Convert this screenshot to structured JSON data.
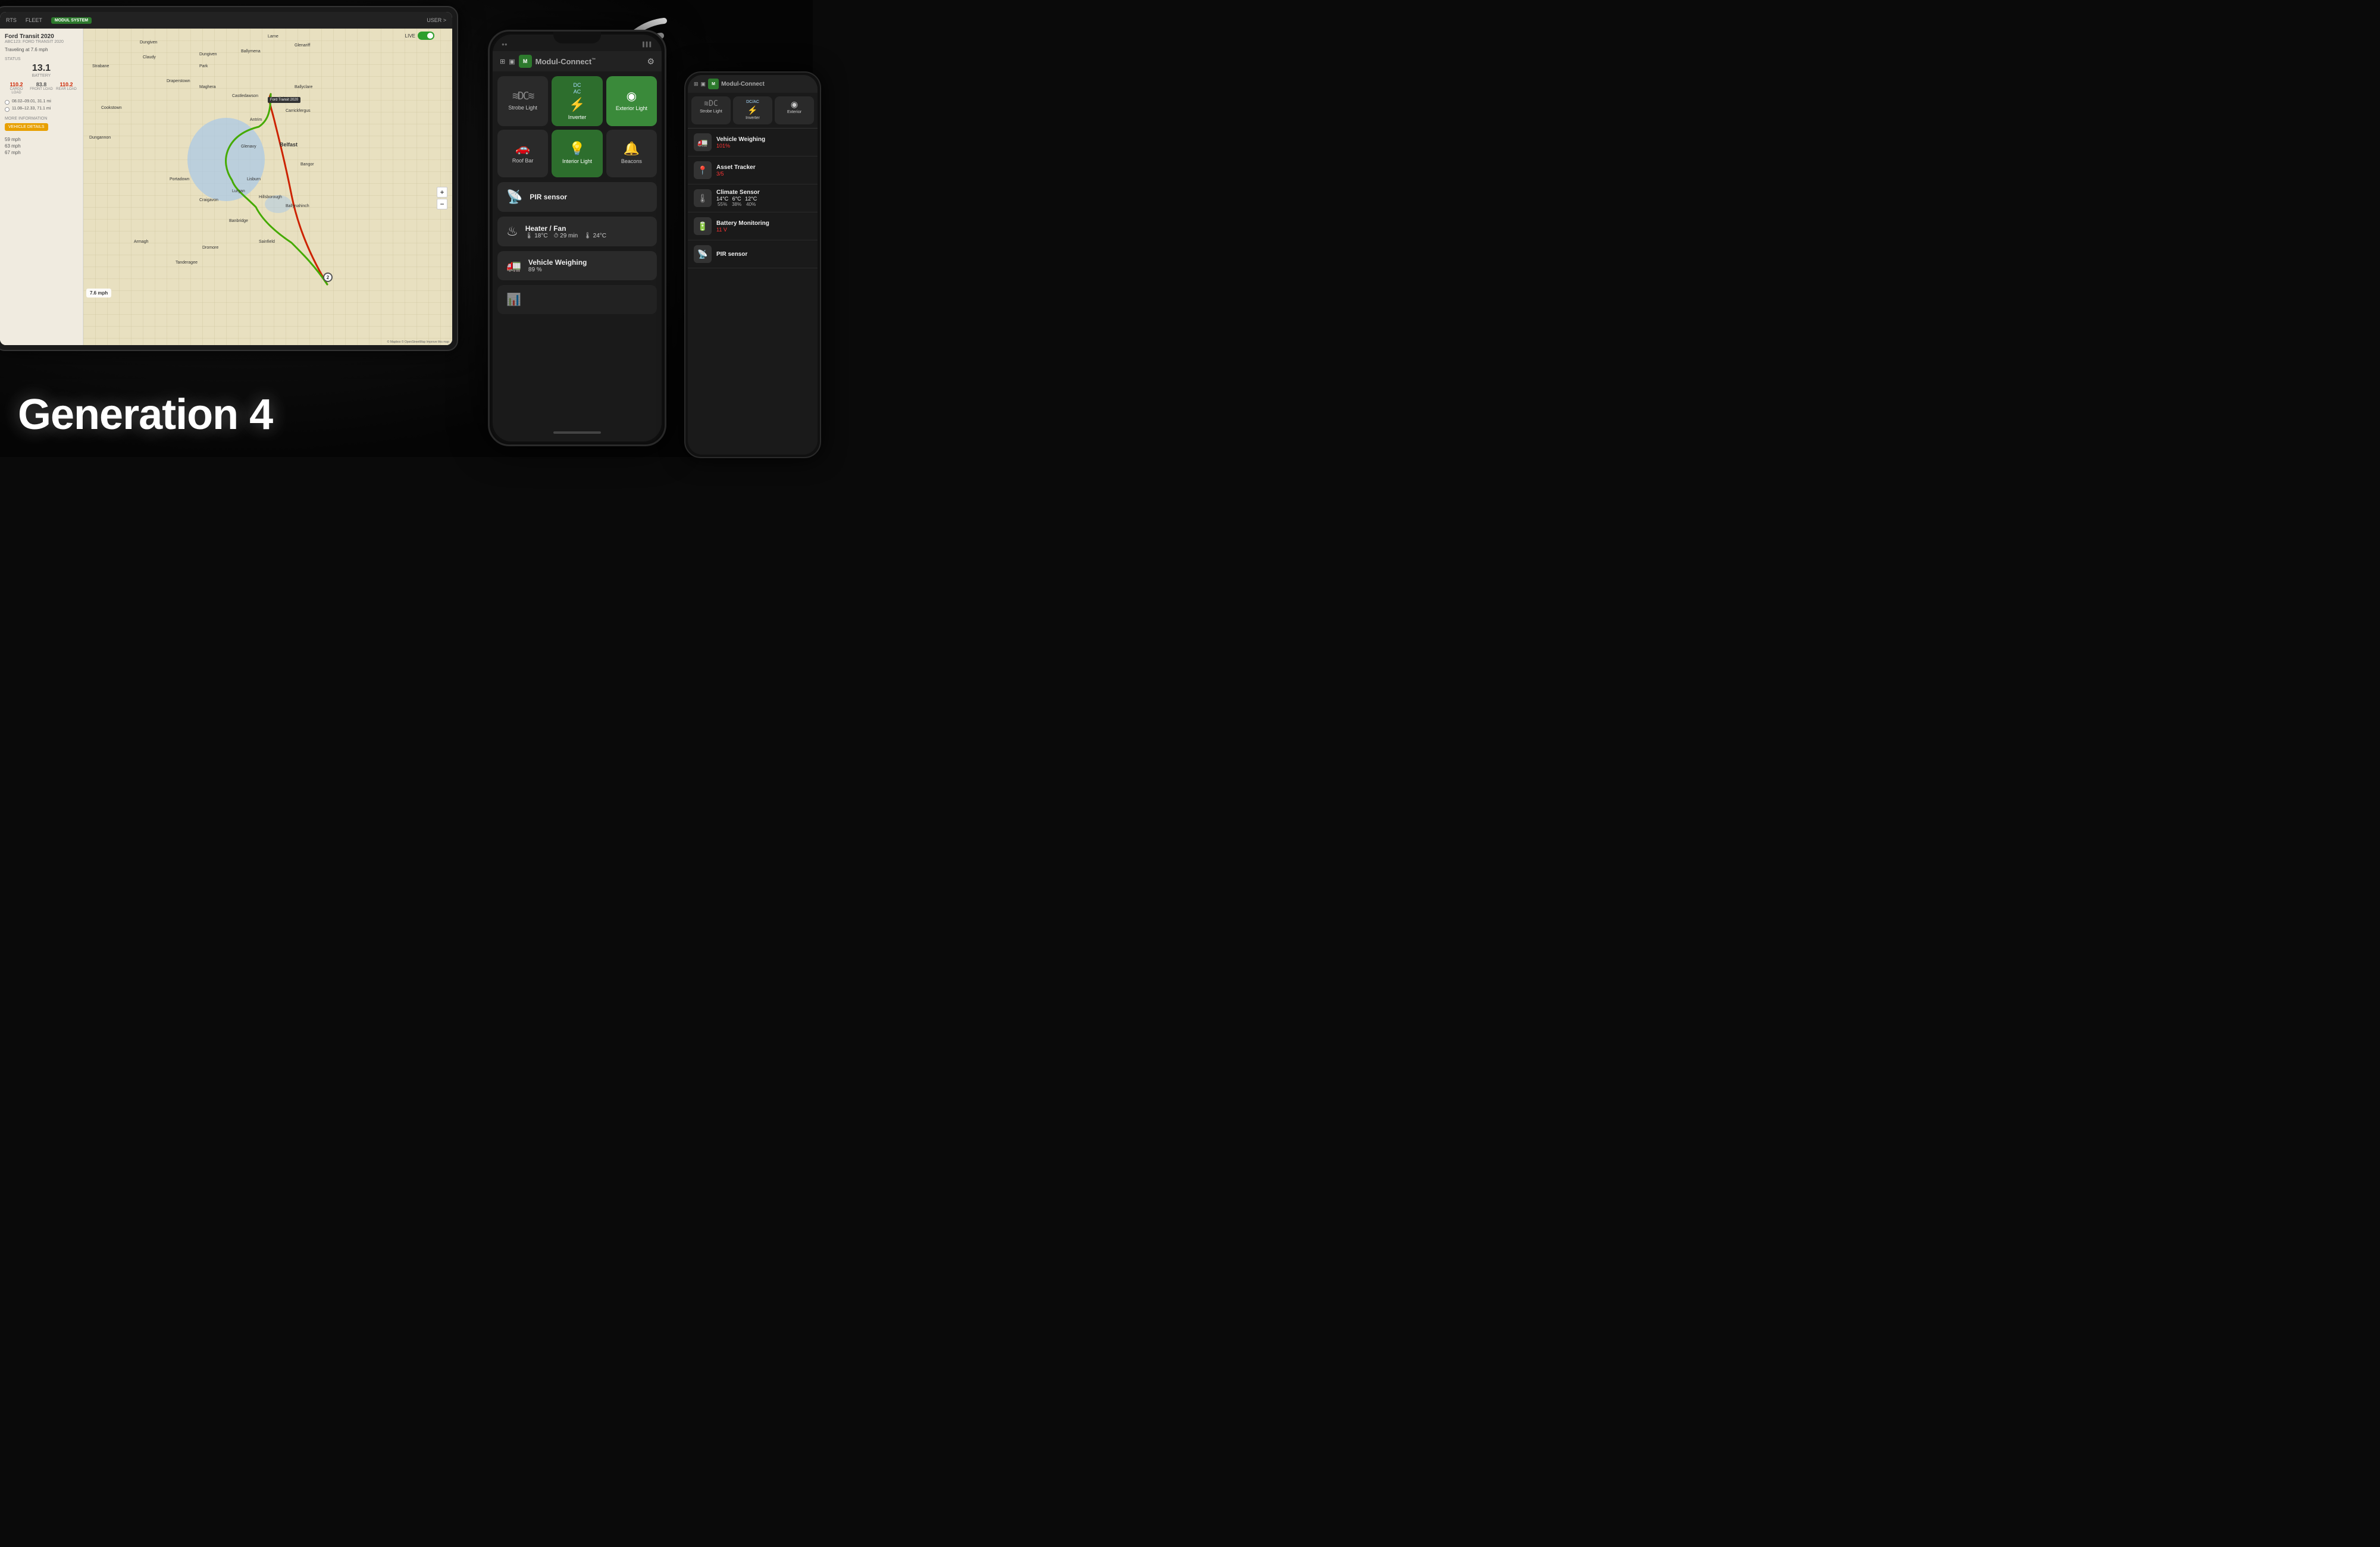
{
  "app": {
    "title": "Modul-Connect™",
    "title_plain": "Modul-Connect",
    "title_tm": "™",
    "subtitle": "Generation 4"
  },
  "tablet": {
    "nav_items": [
      "RTS",
      "FLEET"
    ],
    "modul_badge": "MODUL SYSTEM",
    "user_label": "USER >",
    "vehicle": {
      "name": "Ford Transit 2020",
      "id": "ABC123: FORD TRANSIT 2020",
      "speed_text": "Traveling at 7.6 mph",
      "status_label": "STATUS",
      "battery_value": "13.1",
      "battery_label": "BATTERY",
      "cargo_load": "110.2",
      "cargo_label": "CARGO LOAD",
      "front_load": "83.8",
      "front_label": "FRONT LOAD",
      "rear_load": "110.2",
      "rear_label": "REAR LOAD",
      "trip1": "08.02–09.01, 31.1 mi",
      "trip2": "11.08–12.33, 71.1 mi",
      "more_info": "MORE INFORMATION",
      "vehicle_details_btn": "VEHICLE DETAILS",
      "speed1": "59 mph",
      "speed2": "63 mph",
      "speed3": "67 mph",
      "current_speed": "7.6 mph",
      "live_label": "LIVE"
    },
    "map": {
      "vehicle_marker": "Ford Transit 2020",
      "attribution": "© Mapbox © OpenStreetMap Improve this map",
      "marker_number": "2"
    }
  },
  "phone": {
    "header": {
      "app_name": "Modul-",
      "app_name2": "Connect",
      "app_tm": "™",
      "gear_icon": "⚙",
      "grid_icon": "⊞"
    },
    "grid": [
      {
        "label": "Strobe Light",
        "icon": "≋DC≋",
        "active": false
      },
      {
        "label": "Inverter",
        "sublabel": "DC\nAC",
        "icon": "⚡",
        "active": true
      },
      {
        "label": "Exterior Light",
        "icon": "≡◎≡",
        "active": true
      },
      {
        "label": "Roof Bar",
        "icon": "🚗",
        "active": false
      },
      {
        "label": "Interior Light",
        "icon": "💡",
        "active": true
      },
      {
        "label": "Beacons",
        "icon": "🔔",
        "active": false
      }
    ],
    "sensors": [
      {
        "name": "PIR sensor",
        "icon": "📡",
        "type": "pir"
      },
      {
        "name": "Heater / Fan",
        "icon": "♨",
        "temp": "18°C",
        "time": "29 min",
        "fan_temp": "24°C",
        "type": "heater"
      },
      {
        "name": "Vehicle Weighing",
        "value": "89 %",
        "icon": "🚛",
        "type": "weighing"
      }
    ]
  },
  "phone2": {
    "header": {
      "app_name": "Modul-",
      "app_name2": "Connect"
    },
    "grid_items": [
      {
        "label": "Strobe Light",
        "icon": "≋DC"
      },
      {
        "label": "Inverter",
        "sublabel": "DC/AC",
        "icon": "⚡"
      },
      {
        "label": "Exterior",
        "icon": "◎"
      }
    ],
    "list_items": [
      {
        "name": "Vehicle Weighing",
        "value": "101%",
        "value_color": "red",
        "icon": "🚛"
      },
      {
        "name": "Asset Tracker",
        "value": "3/5",
        "value_color": "red",
        "icon": "📍"
      },
      {
        "name": "Climate Sensor",
        "type": "climate",
        "temps": [
          "14°C",
          "6°C",
          "12°C"
        ],
        "pcts": [
          "55%",
          "38%",
          "40%"
        ]
      },
      {
        "name": "Battery Monitoring",
        "value": "11 V",
        "value_color": "red",
        "icon": "🔋"
      },
      {
        "name": "PIR sensor",
        "icon": "📡",
        "type": "pir"
      }
    ]
  },
  "wifi": {
    "aria": "WiFi connectivity icon"
  },
  "generation": {
    "text": "Generation 4"
  }
}
